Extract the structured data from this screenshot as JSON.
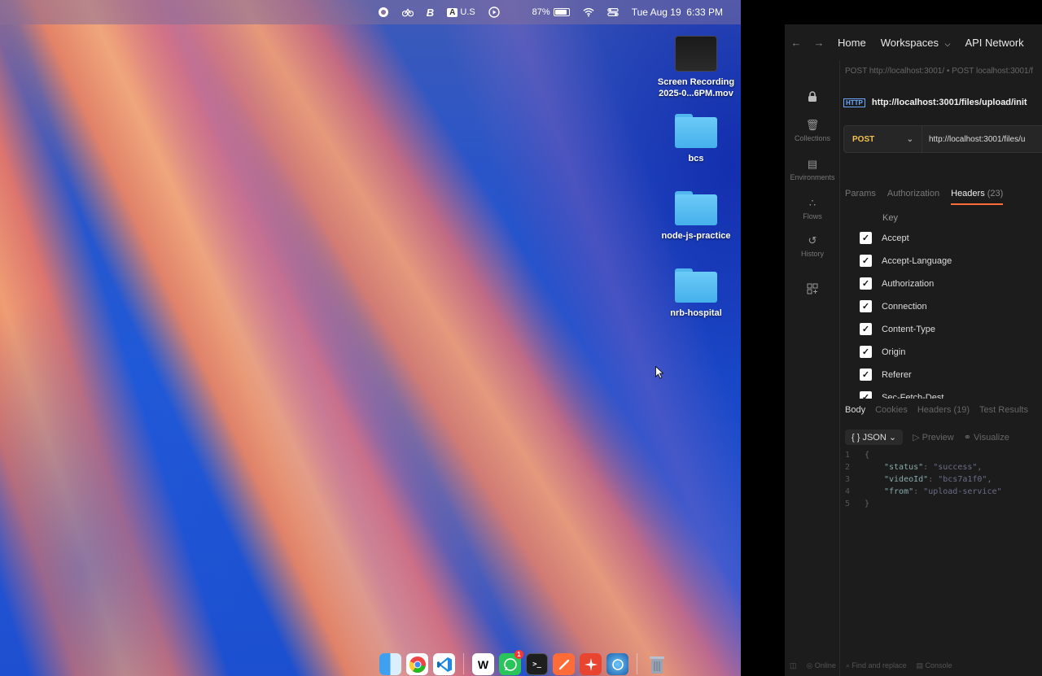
{
  "menubar": {
    "input_source_badge": "A",
    "input_source": "U.S",
    "battery_percent": "87%",
    "clock": "Tue Aug 19  6:33 PM"
  },
  "desktop": {
    "icons": [
      {
        "name": "Screen Recording\n2025-0...6PM.mov",
        "line1": "Screen Recording",
        "line2": "2025-0...6PM.mov",
        "kind": "movie"
      },
      {
        "name": "bcs",
        "kind": "folder"
      },
      {
        "name": "node-js-practice",
        "kind": "folder"
      },
      {
        "name": "nrb-hospital",
        "kind": "folder"
      }
    ]
  },
  "dock": {
    "badge": "1",
    "apps": [
      "finder",
      "chrome",
      "vscode",
      "webstorm",
      "whatsapp",
      "terminal",
      "postman",
      "spark",
      "proxyman",
      "trash"
    ]
  },
  "postman": {
    "nav": {
      "home": "Home",
      "workspaces": "Workspaces",
      "api_network": "API Network"
    },
    "sidebar": [
      {
        "label": "Collections",
        "icon": "trash-can-icon"
      },
      {
        "label": "Environments",
        "icon": "document-icon"
      },
      {
        "label": "Flows",
        "icon": "share-icon"
      },
      {
        "label": "History",
        "icon": "history-icon"
      }
    ],
    "open_tabs": "POST http://localhost:3001/  •  POST localhost:3001/f",
    "request_title": "http://localhost:3001/files/upload/init",
    "method": "POST",
    "url": "http://localhost:3001/files/u",
    "request_tabs": {
      "params": "Params",
      "authorization": "Authorization",
      "headers": "Headers",
      "headers_count": "(23)"
    },
    "headers_table": {
      "key_column": "Key",
      "rows": [
        "Accept",
        "Accept-Language",
        "Authorization",
        "Connection",
        "Content-Type",
        "Origin",
        "Referer",
        "Sec-Fetch-Dest"
      ]
    },
    "response_tabs": {
      "body": "Body",
      "cookies": "Cookies",
      "headers": "Headers (19)",
      "test_results": "Test Results"
    },
    "response_tools": {
      "format": "JSON",
      "preview": "Preview",
      "visualize": "Visualize"
    },
    "response_lines": [
      {
        "n": "1",
        "text": "{"
      },
      {
        "n": "2",
        "key": "\"status\"",
        "value": "\"success\","
      },
      {
        "n": "3",
        "key": "\"videoId\"",
        "value": "\"bcs7a1f0\","
      },
      {
        "n": "4",
        "key": "\"from\"",
        "value": "\"upload-service\""
      },
      {
        "n": "5",
        "text": "}"
      }
    ],
    "status_bar": {
      "online": "Online",
      "find_replace": "Find and replace",
      "console": "Console"
    }
  }
}
